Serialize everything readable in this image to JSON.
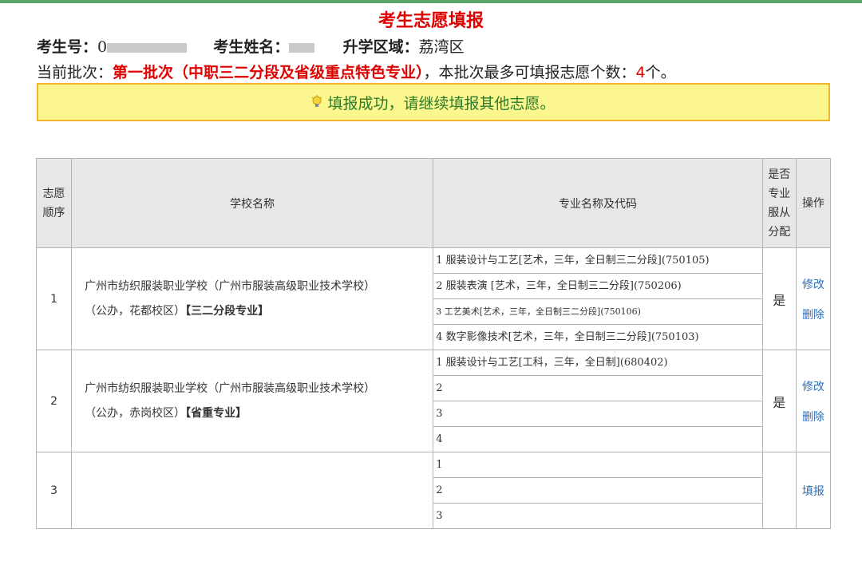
{
  "page": {
    "title": "考生志愿填报"
  },
  "student": {
    "id_label": "考生号：",
    "id_value_visible": "0",
    "name_label": "考生姓名：",
    "district_label": "升学区域：",
    "district_value": "荔湾区"
  },
  "batch": {
    "prefix": "当前批次：",
    "name": "第一批次（中职三二分段及省级重点特色专业）",
    "middle": "，本批次最多可填报志愿个数：",
    "count": "4",
    "suffix": "个。"
  },
  "notice": {
    "message": "填报成功，请继续填报其他志愿。",
    "icon": "lightbulb-icon"
  },
  "table": {
    "headers": {
      "order": "志愿顺序",
      "school": "学校名称",
      "major": "专业名称及代码",
      "obey": "是否专业服从分配",
      "ops": "操作"
    },
    "rows": [
      {
        "order": "1",
        "school_line1": "广州市纺织服装职业学校（广州市服装高级职业技术学校）",
        "school_line2": "（公办，花都校区）",
        "school_tag": "【三二分段专业】",
        "majors": [
          "1 服装设计与工艺[艺术，三年，全日制三二分段](750105)",
          "2 服装表演 [艺术，三年，全日制三二分段](750206)",
          "3 工艺美术[艺术，三年，全日制三二分段](750106)",
          "4 数字影像技术[艺术，三年，全日制三二分段](750103)"
        ],
        "obey": "是",
        "edit_label": "修改",
        "delete_label": "删除"
      },
      {
        "order": "2",
        "school_line1": "广州市纺织服装职业学校（广州市服装高级职业技术学校）",
        "school_line2": "（公办，赤岗校区）",
        "school_tag": "【省重专业】",
        "majors": [
          "1 服装设计与工艺[工科，三年，全日制](680402)",
          "2",
          "3",
          "4"
        ],
        "obey": "是",
        "edit_label": "修改",
        "delete_label": "删除"
      },
      {
        "order": "3",
        "majors": [
          "1",
          "2",
          "3"
        ],
        "fill_label": "填报"
      }
    ]
  }
}
